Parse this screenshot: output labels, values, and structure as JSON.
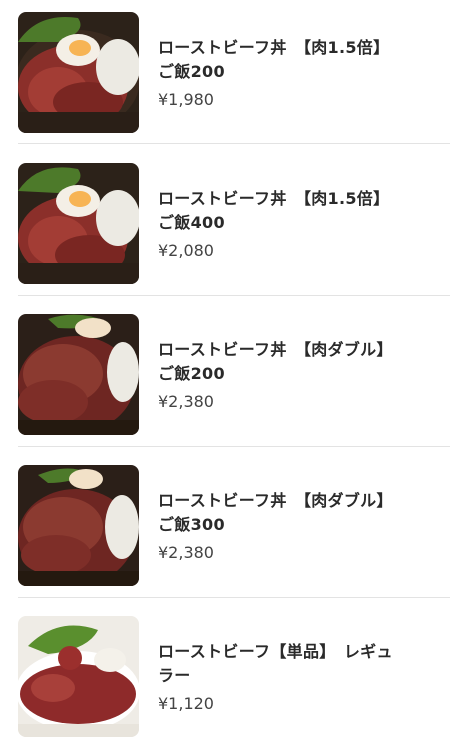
{
  "menu": {
    "items": [
      {
        "name": "ローストビーフ丼　【肉1.5倍】ご飯200",
        "price": "¥1,980",
        "image": "roast-beef-bowl-photo"
      },
      {
        "name": "ローストビーフ丼　【肉1.5倍】ご飯400",
        "price": "¥2,080",
        "image": "roast-beef-bowl-photo"
      },
      {
        "name": "ローストビーフ丼　【肉ダブル】　ご飯200",
        "price": "¥2,380",
        "image": "roast-beef-bowl-double-photo"
      },
      {
        "name": "ローストビーフ丼　【肉ダブル】　ご飯300",
        "price": "¥2,380",
        "image": "roast-beef-bowl-double-photo"
      },
      {
        "name": "ローストビーフ【単品】　レギュラー",
        "price": "¥1,120",
        "image": "roast-beef-plate-photo"
      }
    ]
  }
}
